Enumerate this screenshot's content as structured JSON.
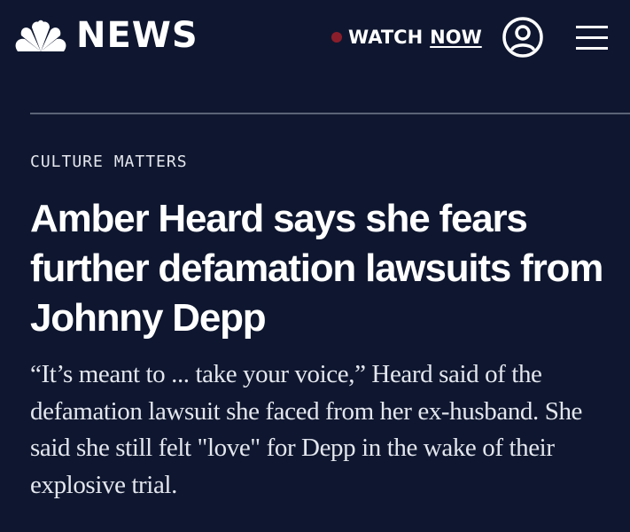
{
  "header": {
    "logo_text": "NEWS",
    "watch_label": "WATCH",
    "watch_now_label": "NOW",
    "icons": [
      "peacock-logo-icon",
      "account-icon",
      "menu-icon"
    ],
    "live_dot_color": "#8b1e2b"
  },
  "article": {
    "section": "CULTURE MATTERS",
    "headline": "Amber Heard says she fears further defamation lawsuits from Johnny Depp",
    "dek": "“It’s meant to ... take your voice,” Heard said of the defamation lawsuit she faced from her ex-husband. She said she still felt \"love\" for Depp in the wake of their explosive trial."
  },
  "colors": {
    "background": "#0f1730",
    "text": "#ffffff",
    "divider": "#5b6478"
  }
}
